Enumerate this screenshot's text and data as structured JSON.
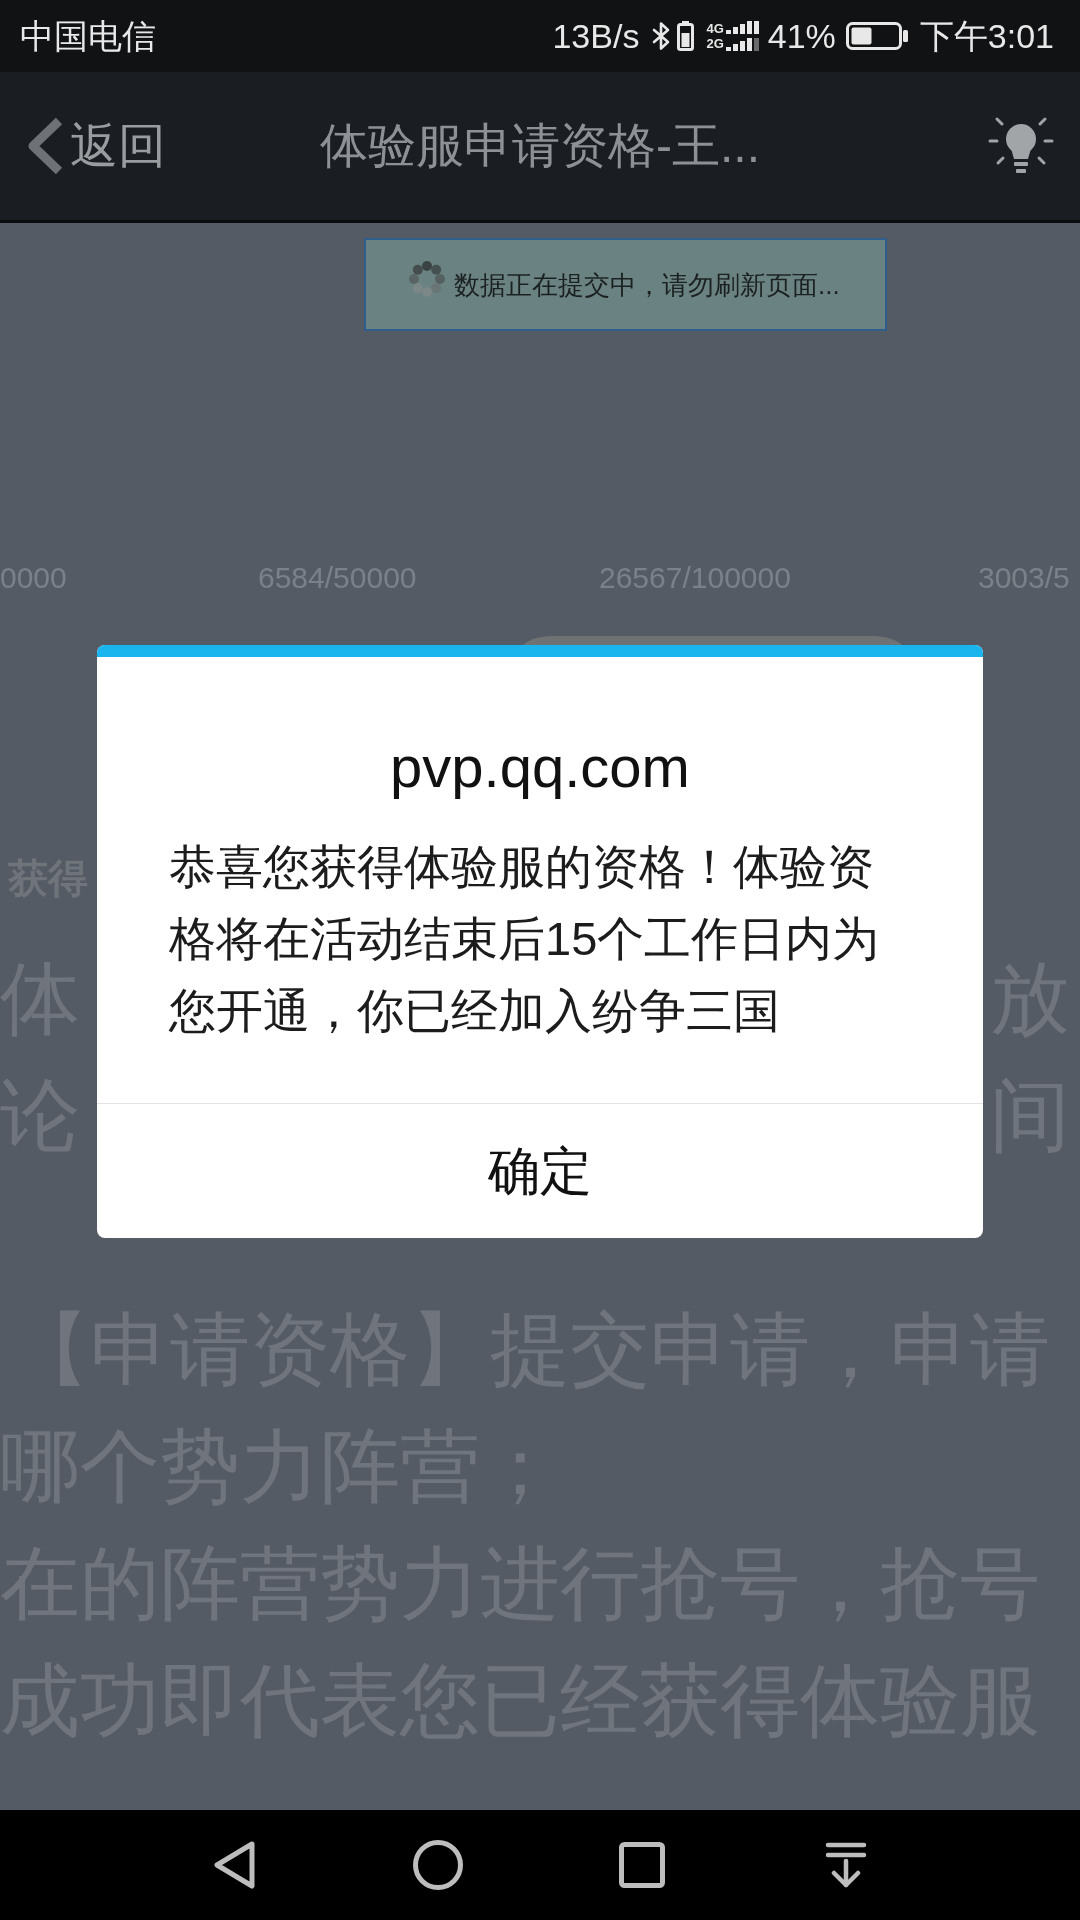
{
  "status_bar": {
    "carrier": "中国电信",
    "speed": "13B/s",
    "network_top": "4G",
    "network_bottom": "2G",
    "battery": "41%",
    "time": "下午3:01"
  },
  "header": {
    "back": "返回",
    "title": "体验服申请资格-王..."
  },
  "toast": {
    "text": "数据正在提交中，请勿刷新页面..."
  },
  "background": {
    "counts": [
      "0000",
      "6584/50000",
      "26567/100000",
      "3003/5"
    ],
    "label": "获得",
    "side_lines": [
      {
        "left": "体",
        "right": "放"
      },
      {
        "left": "论",
        "right": "间"
      }
    ],
    "lines": [
      "【申请资格】提交申请，申请",
      "哪个势力阵营；",
      "在的阵营势力进行抢号，抢号",
      "成功即代表您已经获得体验服"
    ]
  },
  "dialog": {
    "title": "pvp.qq.com",
    "message": "恭喜您获得体验服的资格！体验资格将在活动结束后15个工作日内为您开通，你已经加入纷争三国",
    "button": "确定"
  }
}
